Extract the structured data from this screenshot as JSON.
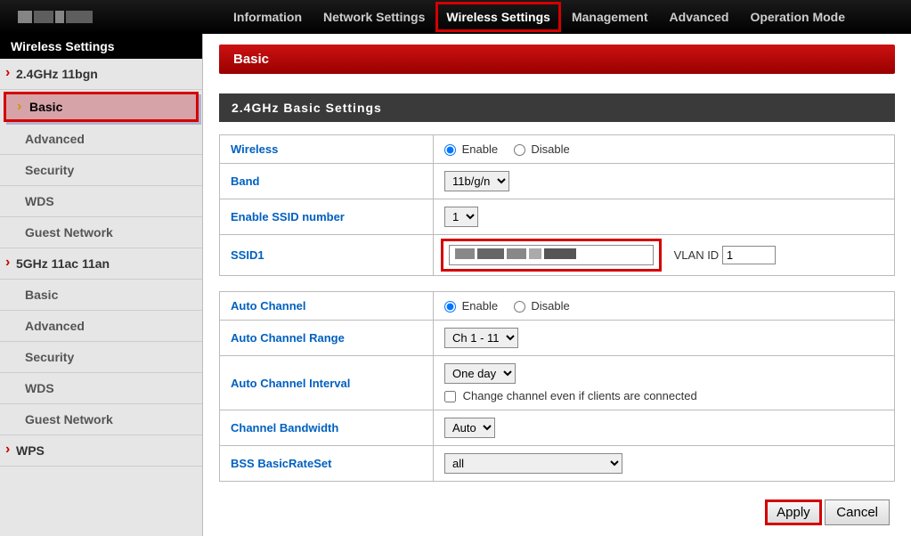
{
  "topnav": {
    "items": [
      "Information",
      "Network Settings",
      "Wireless Settings",
      "Management",
      "Advanced",
      "Operation Mode"
    ],
    "activeIndex": 2
  },
  "sidebar": {
    "title": "Wireless Settings",
    "items": [
      {
        "label": "2.4GHz 11bgn",
        "type": "category"
      },
      {
        "label": "Basic",
        "type": "sub",
        "highlighted": true
      },
      {
        "label": "Advanced",
        "type": "sub"
      },
      {
        "label": "Security",
        "type": "sub"
      },
      {
        "label": "WDS",
        "type": "sub"
      },
      {
        "label": "Guest Network",
        "type": "sub"
      },
      {
        "label": "5GHz 11ac 11an",
        "type": "category"
      },
      {
        "label": "Basic",
        "type": "sub"
      },
      {
        "label": "Advanced",
        "type": "sub"
      },
      {
        "label": "Security",
        "type": "sub"
      },
      {
        "label": "WDS",
        "type": "sub"
      },
      {
        "label": "Guest Network",
        "type": "sub"
      },
      {
        "label": "WPS",
        "type": "category"
      }
    ]
  },
  "page": {
    "title": "Basic",
    "sectionTitle": "2.4GHz Basic Settings"
  },
  "form": {
    "wireless": {
      "label": "Wireless",
      "enable": "Enable",
      "disable": "Disable",
      "value": "enable"
    },
    "band": {
      "label": "Band",
      "options": [
        "11b/g/n"
      ],
      "value": "11b/g/n"
    },
    "ssidNumber": {
      "label": "Enable SSID number",
      "options": [
        "1"
      ],
      "value": "1"
    },
    "ssid1": {
      "label": "SSID1",
      "value": "",
      "vlanLabel": "VLAN ID",
      "vlanValue": "1"
    },
    "autoChannel": {
      "label": "Auto Channel",
      "enable": "Enable",
      "disable": "Disable",
      "value": "enable"
    },
    "autoChannelRange": {
      "label": "Auto Channel Range",
      "options": [
        "Ch 1 - 11"
      ],
      "value": "Ch 1 - 11"
    },
    "autoChannelInterval": {
      "label": "Auto Channel Interval",
      "options": [
        "One day"
      ],
      "value": "One day",
      "checkboxLabel": "Change channel even if clients are connected"
    },
    "channelBandwidth": {
      "label": "Channel Bandwidth",
      "options": [
        "Auto"
      ],
      "value": "Auto"
    },
    "bssRateSet": {
      "label": "BSS BasicRateSet",
      "options": [
        "all"
      ],
      "value": "all"
    }
  },
  "buttons": {
    "apply": "Apply",
    "cancel": "Cancel"
  }
}
